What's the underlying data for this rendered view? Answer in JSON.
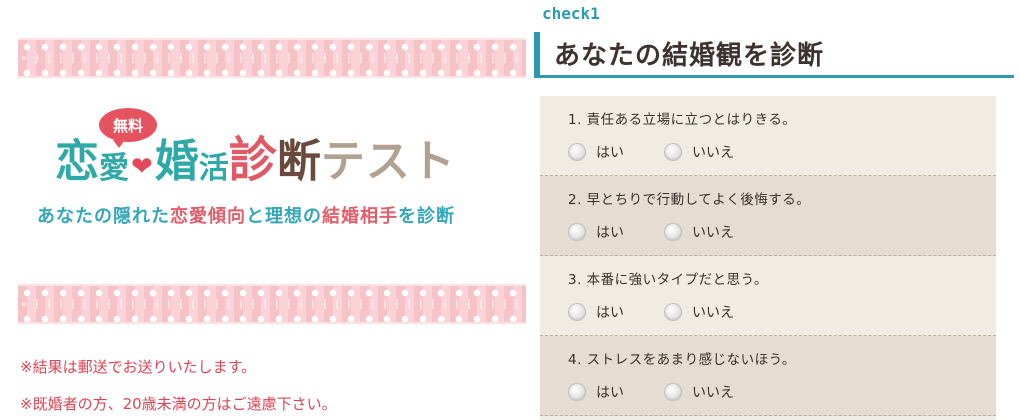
{
  "banner": {
    "badge": "無料",
    "logo_parts": [
      "恋",
      "愛",
      "婚",
      "活",
      "診",
      "断",
      "テスト"
    ],
    "subtitle_parts": [
      {
        "text": "あなたの隠れた",
        "color": "teal"
      },
      {
        "text": "恋愛傾向",
        "color": "pink"
      },
      {
        "text": "と理想の",
        "color": "teal"
      },
      {
        "text": "結婚相手",
        "color": "pink"
      },
      {
        "text": "を診断",
        "color": "teal"
      }
    ]
  },
  "notes": [
    "※結果は郵送でお送りいたします。",
    "※既婚者の方、20歳未満の方はご遠慮下さい。"
  ],
  "form": {
    "check_label": "check1",
    "title": "あなたの結婚観を診断",
    "questions": [
      {
        "text": "1.  責任ある立場に立つとはりきる。",
        "yes": "はい",
        "no": "いいえ"
      },
      {
        "text": "2.  早とちりで行動してよく後悔する。",
        "yes": "はい",
        "no": "いいえ"
      },
      {
        "text": "3.  本番に強いタイプだと思う。",
        "yes": "はい",
        "no": "いいえ"
      },
      {
        "text": "4.  ストレスをあまり感じないほう。",
        "yes": "はい",
        "no": "いいえ"
      }
    ]
  },
  "colors": {
    "accent_teal": "#2a9aac",
    "note_red": "#e04556",
    "lace_pink": "#f6c2c7"
  }
}
